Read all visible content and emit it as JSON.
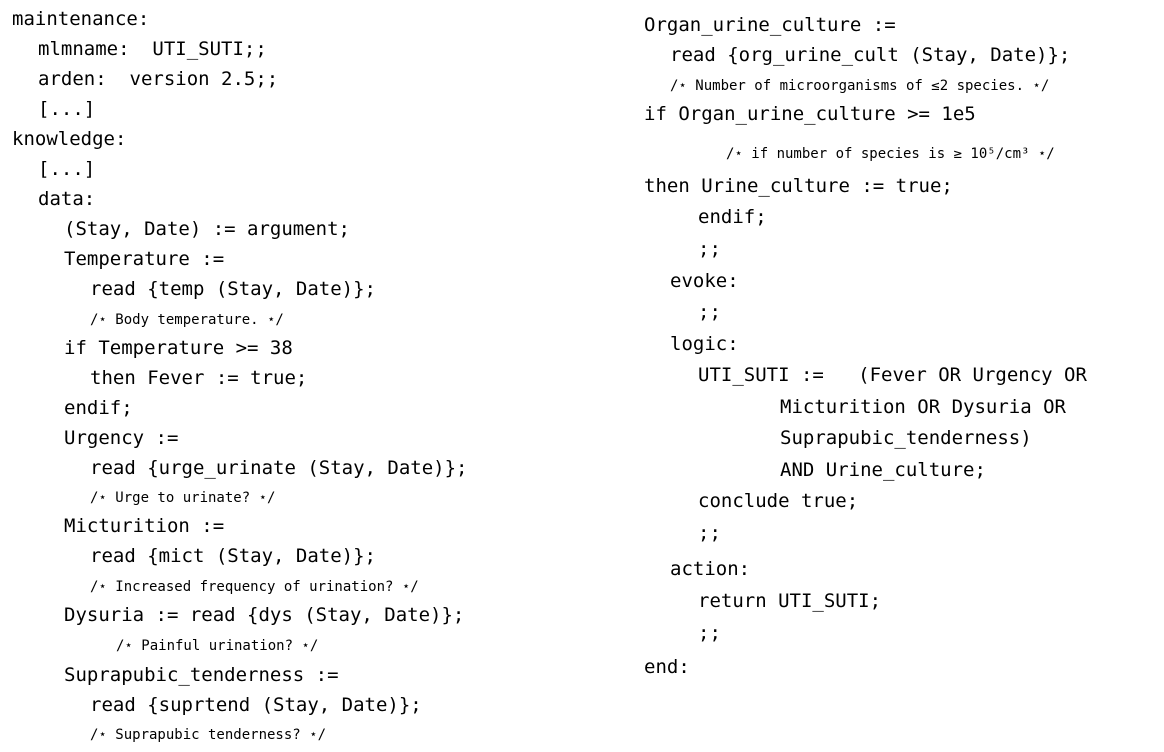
{
  "left_column": [
    {
      "text": "maintenance:"
    },
    {
      "text": "mlmname:  UTI_SUTI;;"
    },
    {
      "text": "arden:  version 2.5;;"
    },
    {
      "text": "[...]"
    },
    {
      "text": "knowledge:"
    },
    {
      "text": "[...]"
    },
    {
      "text": "data:"
    },
    {
      "text": "(Stay, Date) := argument;"
    },
    {
      "text": "Temperature :="
    },
    {
      "text": "read {temp (Stay, Date)};"
    },
    {
      "text": "/⋆ Body temperature. ⋆/"
    },
    {
      "text": "if Temperature >= 38"
    },
    {
      "text": "then Fever := true;"
    },
    {
      "text": "endif;"
    },
    {
      "text": "Urgency :="
    },
    {
      "text": "read {urge_urinate (Stay, Date)};"
    },
    {
      "text": "/⋆ Urge to urinate? ⋆/"
    },
    {
      "text": "Micturition :="
    },
    {
      "text": "read {mict (Stay, Date)};"
    },
    {
      "text": "/⋆ Increased frequency of urination? ⋆/"
    },
    {
      "text": "Dysuria := read {dys (Stay, Date)};"
    },
    {
      "text": "/⋆ Painful urination? ⋆/"
    },
    {
      "text": "Suprapubic_tenderness :="
    },
    {
      "text": "read {suprtend (Stay, Date)};"
    },
    {
      "text": "/⋆ Suprapubic tenderness? ⋆/"
    }
  ],
  "right_column": [
    {
      "text": "Organ_urine_culture :="
    },
    {
      "text": "read {org_urine_cult (Stay, Date)};"
    },
    {
      "text": "/⋆ Number of microorganisms of ≤2 species. ⋆/"
    },
    {
      "text": "if Organ_urine_culture >= 1e5"
    },
    {
      "text": "/⋆ if number of species is ≥ 10⁵/cm³ ⋆/"
    },
    {
      "text": "then Urine_culture := true;"
    },
    {
      "text": "endif;"
    },
    {
      "text": ";;"
    },
    {
      "text": "evoke:"
    },
    {
      "text": ";;"
    },
    {
      "text": "logic:"
    },
    {
      "text": "UTI_SUTI :=   (Fever OR Urgency OR"
    },
    {
      "text": "Micturition OR Dysuria OR"
    },
    {
      "text": "Suprapubic_tenderness)"
    },
    {
      "text": "AND Urine_culture;"
    },
    {
      "text": "conclude true;"
    },
    {
      "text": ";;"
    },
    {
      "text": "action:"
    },
    {
      "text": "return UTI_SUTI;"
    },
    {
      "text": ";;"
    },
    {
      "text": "end:"
    }
  ]
}
